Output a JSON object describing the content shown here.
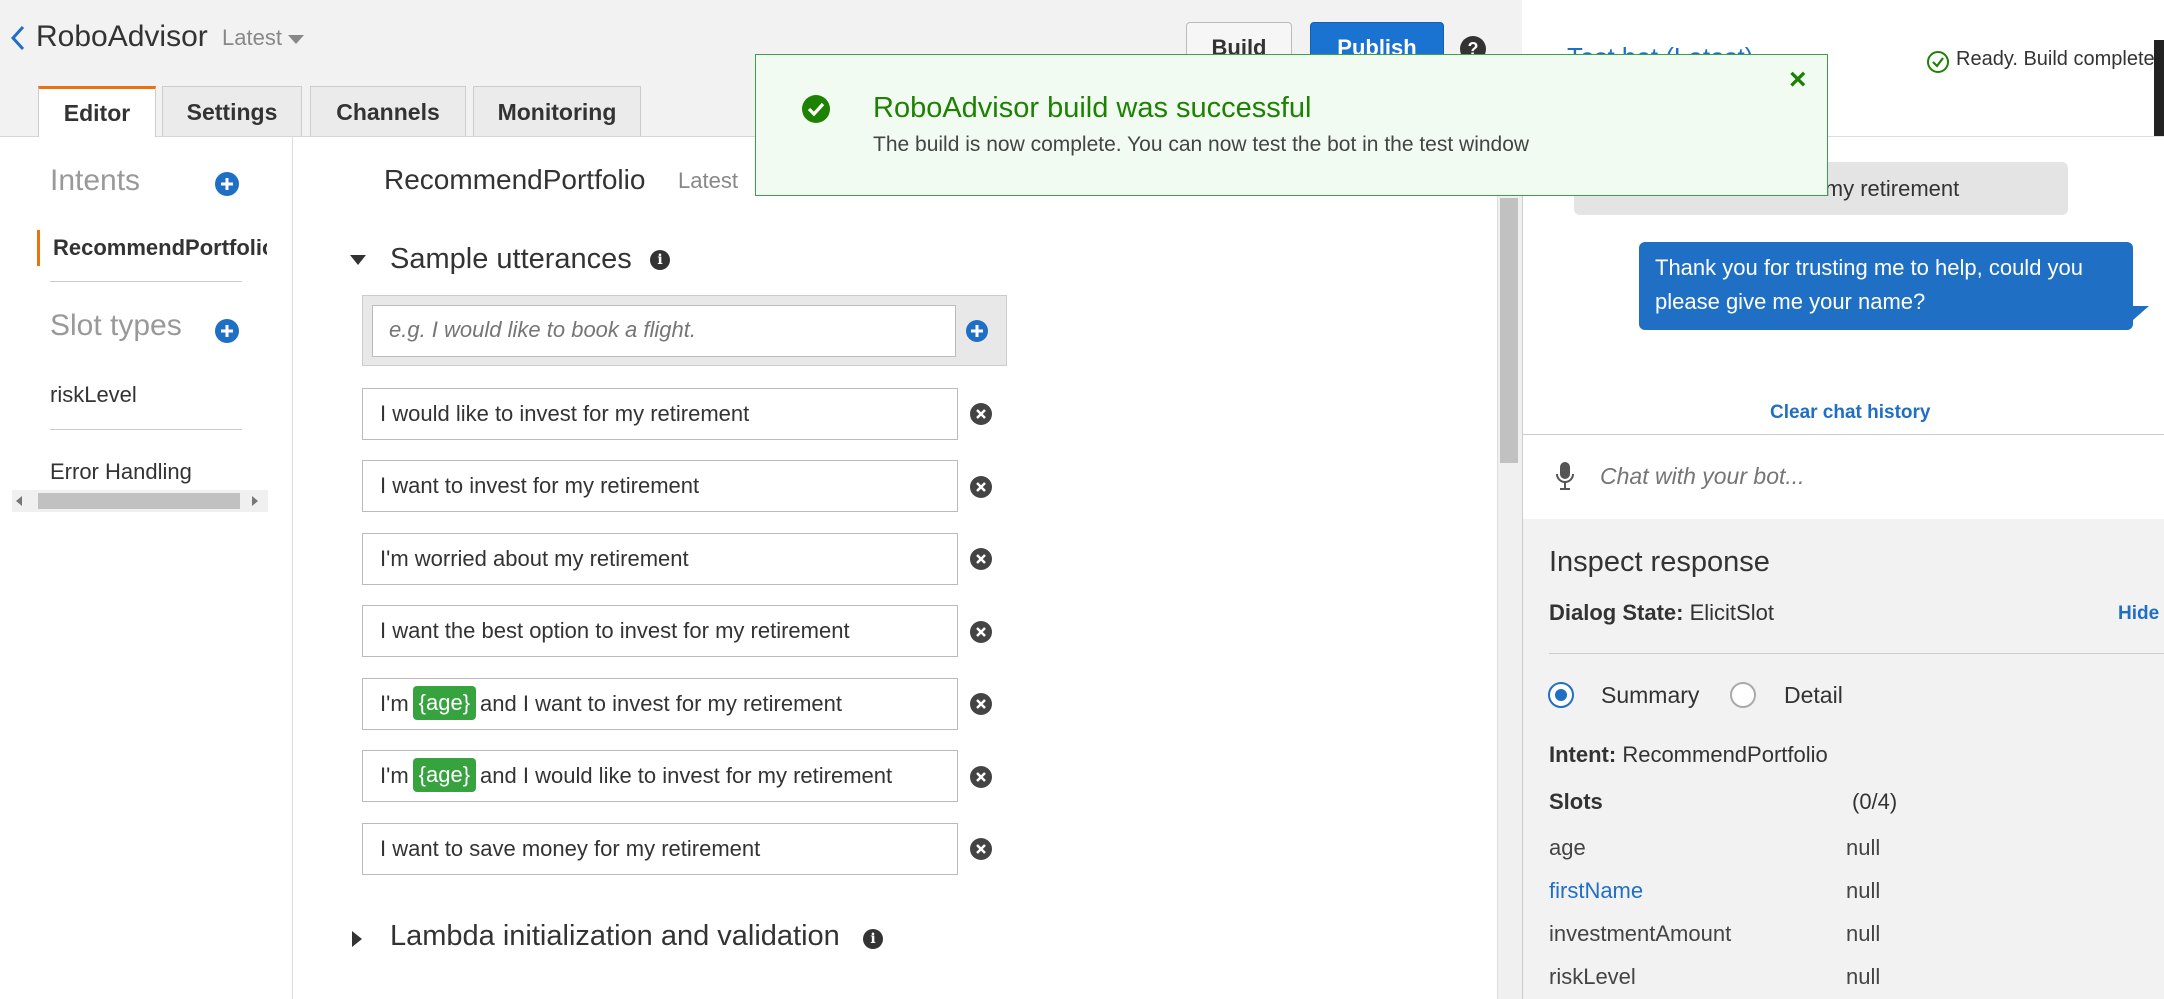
{
  "header": {
    "app_name": "RoboAdvisor",
    "version": "Latest",
    "build_label": "Build",
    "publish_label": "Publish",
    "help_label": "?"
  },
  "tabs": [
    {
      "label": "Editor",
      "active": true
    },
    {
      "label": "Settings",
      "active": false
    },
    {
      "label": "Channels",
      "active": false
    },
    {
      "label": "Monitoring",
      "active": false
    }
  ],
  "sidebar": {
    "intents_heading": "Intents",
    "intents": [
      "RecommendPortfolio"
    ],
    "slot_types_heading": "Slot types",
    "slot_types": [
      "riskLevel"
    ],
    "error_handling_label": "Error Handling"
  },
  "editor": {
    "intent_title": "RecommendPortfolio",
    "intent_version": "Latest",
    "sample_utterances_heading": "Sample utterances",
    "utterance_placeholder": "e.g. I would like to book a flight.",
    "utterances": [
      {
        "parts": [
          "I would like to invest for my retirement"
        ]
      },
      {
        "parts": [
          "I want to invest for my retirement"
        ]
      },
      {
        "parts": [
          "I'm worried about my retirement"
        ]
      },
      {
        "parts": [
          "I want the best option to invest for my retirement"
        ]
      },
      {
        "pre": "I'm",
        "slot": "{age}",
        "post": "and I want to invest for my retirement"
      },
      {
        "pre": "I'm",
        "slot": "{age}",
        "post": "and I would like to invest for my retirement"
      },
      {
        "parts": [
          "I want to save money for my retirement"
        ]
      }
    ],
    "lambda_heading": "Lambda initialization and validation"
  },
  "flash": {
    "title": "RoboAdvisor build was successful",
    "message": "The build is now complete. You can now test the bot in the test window",
    "close_glyph": "×"
  },
  "test_panel": {
    "title_partial": "Test bot (Latest)",
    "status": "Ready. Build complete",
    "user_message": "I would like to invest for my retirement",
    "bot_message": "Thank you for trusting me to help, could you please give me your name?",
    "clear_history": "Clear chat history",
    "chat_placeholder": "Chat with your bot...",
    "inspect_heading": "Inspect response",
    "dialog_state_label": "Dialog State:",
    "dialog_state_value": "ElicitSlot",
    "hide_label": "Hide",
    "radio_summary": "Summary",
    "radio_detail": "Detail",
    "intent_label": "Intent:",
    "intent_value": "RecommendPortfolio",
    "slots_label": "Slots",
    "slots_count": "(0/4)",
    "slots": [
      {
        "name": "age",
        "value": "null",
        "highlight": false
      },
      {
        "name": "firstName",
        "value": "null",
        "highlight": true
      },
      {
        "name": "investmentAmount",
        "value": "null",
        "highlight": false
      },
      {
        "name": "riskLevel",
        "value": "null",
        "highlight": false
      }
    ]
  },
  "colors": {
    "accent_blue": "#1f6fc5",
    "success_green": "#1d8102",
    "tab_active_orange": "#ec7211",
    "slot_green": "#37a33f"
  }
}
